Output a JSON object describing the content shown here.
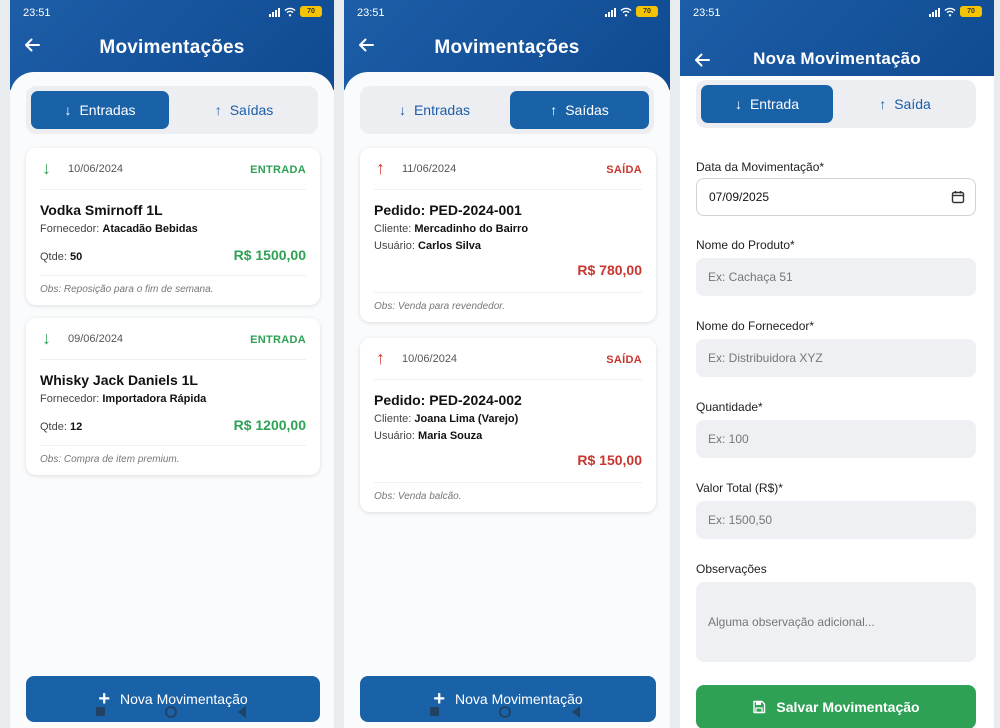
{
  "status": {
    "time": "23:51",
    "battery": "70"
  },
  "screen_entradas": {
    "title": "Movimentações",
    "tabs": [
      {
        "icon": "↓",
        "label": "Entradas"
      },
      {
        "icon": "↑",
        "label": "Saídas"
      }
    ],
    "cards": [
      {
        "date": "10/06/2024",
        "badge": "ENTRADA",
        "product": "Vodka Smirnoff 1L",
        "supplier_label": "Fornecedor:",
        "supplier": "Atacadão Bebidas",
        "qty_label": "Qtde:",
        "qty": "50",
        "amount": "R$ 1500,00",
        "obs": "Obs: Reposição para o fim de semana."
      },
      {
        "date": "09/06/2024",
        "badge": "ENTRADA",
        "product": "Whisky Jack Daniels 1L",
        "supplier_label": "Fornecedor:",
        "supplier": "Importadora Rápida",
        "qty_label": "Qtde:",
        "qty": "12",
        "amount": "R$ 1200,00",
        "obs": "Obs: Compra de item premium."
      }
    ],
    "action_label": "Nova Movimentação"
  },
  "screen_saidas": {
    "title": "Movimentações",
    "tabs": [
      {
        "icon": "↓",
        "label": "Entradas"
      },
      {
        "icon": "↑",
        "label": "Saídas"
      }
    ],
    "cards": [
      {
        "date": "11/06/2024",
        "badge": "SAÍDA",
        "order": "Pedido: PED-2024-001",
        "client_label": "Cliente:",
        "client": "Mercadinho do Bairro",
        "user_label": "Usuário:",
        "user": "Carlos Silva",
        "amount": "R$ 780,00",
        "obs": "Obs: Venda para revendedor."
      },
      {
        "date": "10/06/2024",
        "badge": "SAÍDA",
        "order": "Pedido: PED-2024-002",
        "client_label": "Cliente:",
        "client": "Joana Lima (Varejo)",
        "user_label": "Usuário:",
        "user": "Maria Souza",
        "amount": "R$ 150,00",
        "obs": "Obs: Venda balcão."
      }
    ],
    "action_label": "Nova Movimentação"
  },
  "screen_form": {
    "title": "Nova Movimentação",
    "tabs": [
      {
        "icon": "↓",
        "label": "Entrada"
      },
      {
        "icon": "↑",
        "label": "Saída"
      }
    ],
    "fields": {
      "date": {
        "label": "Data da Movimentação*",
        "value": "07/09/2025"
      },
      "product": {
        "label": "Nome do Produto*",
        "placeholder": "Ex: Cachaça 51"
      },
      "supplier": {
        "label": "Nome do Fornecedor*",
        "placeholder": "Ex: Distribuidora XYZ"
      },
      "quantity": {
        "label": "Quantidade*",
        "placeholder": "Ex: 100"
      },
      "total": {
        "label": "Valor Total (R$)*",
        "placeholder": "Ex: 1500,50"
      },
      "notes": {
        "label": "Observações",
        "placeholder": "Alguma observação adicional..."
      }
    },
    "save_label": "Salvar Movimentação"
  },
  "colors": {
    "primary": "#1962a8",
    "header": "#1d5ea8",
    "entrada": "#2ea155",
    "saida": "#c8362f"
  }
}
